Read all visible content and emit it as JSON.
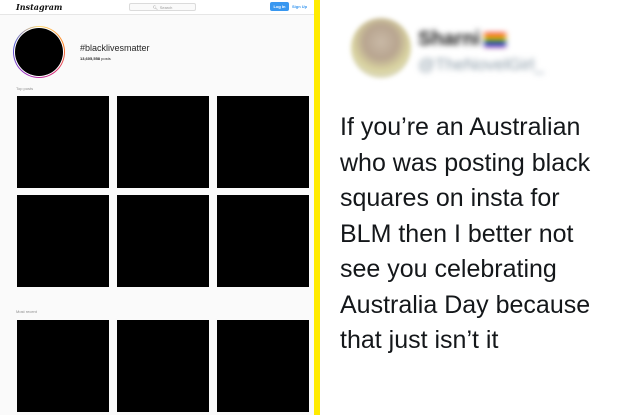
{
  "instagram": {
    "logo": "Instagram",
    "search_placeholder": "Search",
    "login_label": "Log In",
    "signup_label": "Sign Up",
    "hashtag": "#blacklivesmatter",
    "post_count": "13,605,558",
    "post_count_suffix": "posts",
    "top_posts_label": "Top posts",
    "most_recent_label": "Most recent",
    "tile_color": "#000000",
    "accent": "#3897f0"
  },
  "tweet": {
    "display_name": "Sharni",
    "handle": "@TheNovelGirl_",
    "text_lines": [
      "If you’re an Australian",
      "who was posting black",
      "squares on insta for",
      "BLM then I better not",
      "see you celebrating",
      "Australia Day because",
      "that just isn’t it"
    ]
  },
  "divider_color": "#ffeb00"
}
